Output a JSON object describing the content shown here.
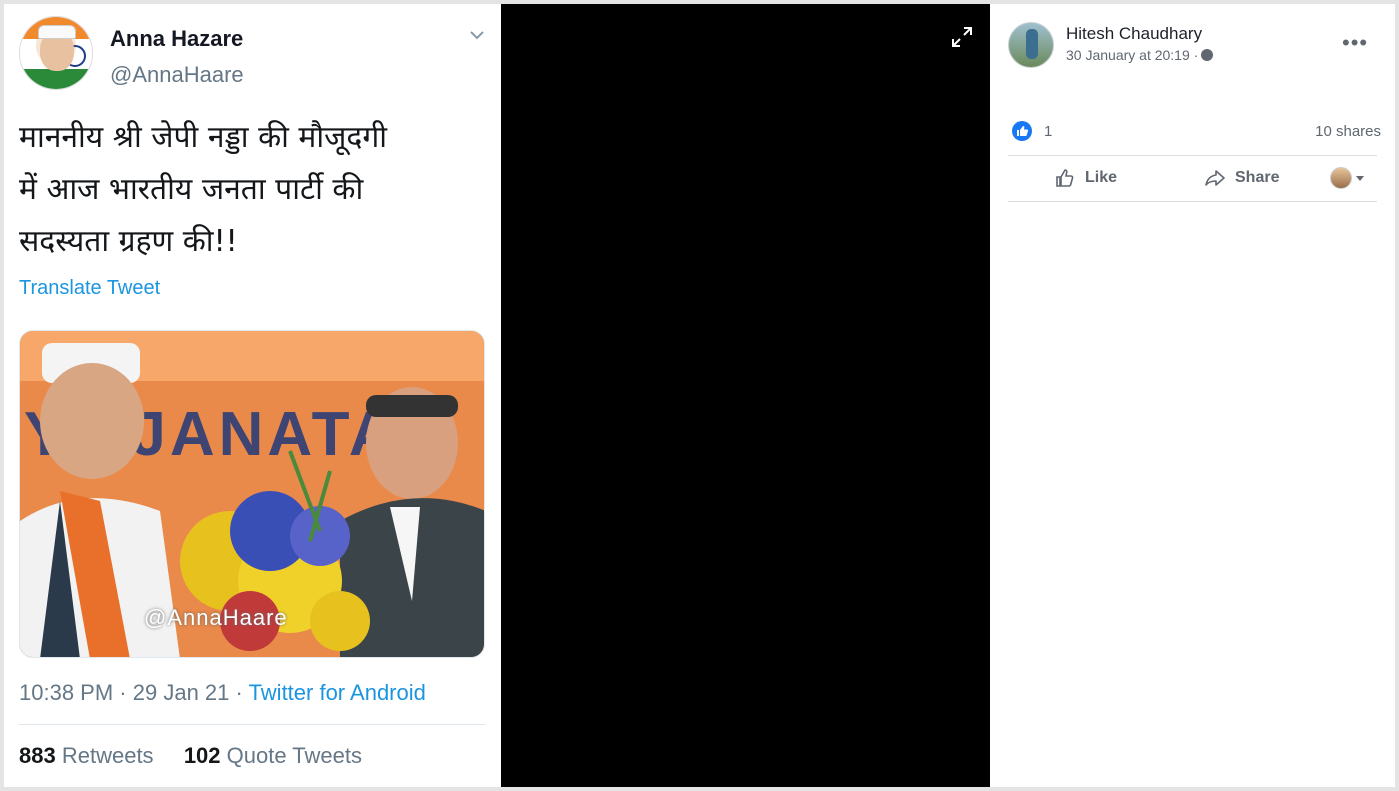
{
  "tweet": {
    "author_name": "Anna Hazare",
    "author_handle": "@AnnaHaare",
    "text_lines": [
      "माननीय श्री जेपी नड्डा की मौजूदगी",
      "में आज भारतीय जनता पार्टी की",
      "सदस्यता ग्रहण की!!"
    ],
    "translate_label": "Translate Tweet",
    "media_background_text": "YA JANATA",
    "media_watermark": "@AnnaHaare",
    "time": "10:38 PM",
    "date": "29 Jan 21",
    "source": "Twitter for Android",
    "retweets_count": "883",
    "retweets_label": "Retweets",
    "quote_count": "102",
    "quote_label": "Quote Tweets"
  },
  "facebook": {
    "poster_name": "Hitesh Chaudhary",
    "timestamp": "30 January at 20:19 ·",
    "more_label": "•••",
    "reaction_count": "1",
    "shares_label": "10 shares",
    "like_label": "Like",
    "share_label": "Share"
  },
  "colors": {
    "twitter_link": "#1b95e0",
    "facebook_blue": "#1877f2",
    "viewer_bg": "#000000"
  }
}
